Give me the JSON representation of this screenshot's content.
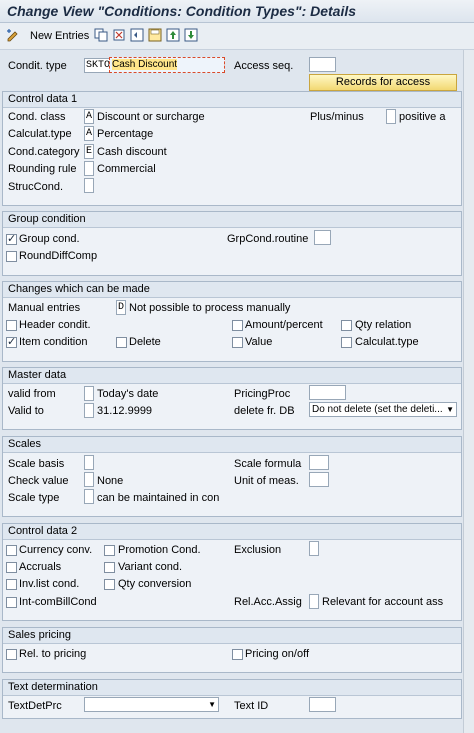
{
  "title": "Change View \"Conditions: Condition Types\": Details",
  "toolbar": {
    "new_entries": "New Entries"
  },
  "header": {
    "condit_type_label": "Condit. type",
    "condit_type_code": "SKTO",
    "condit_type_name": "Cash Discount",
    "access_seq_label": "Access seq.",
    "records_button": "Records for access"
  },
  "control1": {
    "title": "Control data 1",
    "cond_class_label": "Cond. class",
    "cond_class_val": "A",
    "cond_class_text": "Discount or surcharge",
    "plus_minus_label": "Plus/minus",
    "plus_minus_text": "positive a",
    "calculat_label": "Calculat.type",
    "calculat_val": "A",
    "calculat_text": "Percentage",
    "cond_category_label": "Cond.category",
    "cond_category_val": "E",
    "cond_category_text": "Cash discount",
    "rounding_label": "Rounding rule",
    "rounding_text": "Commercial",
    "struc_label": "StrucCond."
  },
  "group_condition": {
    "title": "Group condition",
    "group_cond": "Group cond.",
    "grp_routine": "GrpCond.routine",
    "round_diff": "RoundDiffComp"
  },
  "changes": {
    "title": "Changes which can be made",
    "manual_label": "Manual entries",
    "manual_val": "D",
    "manual_text": "Not possible to process manually",
    "header_condit": "Header condit.",
    "amount_percent": "Amount/percent",
    "qty_relation": "Qty relation",
    "item_condition": "Item condition",
    "delete": "Delete",
    "value": "Value",
    "calculat_type": "Calculat.type"
  },
  "master": {
    "title": "Master data",
    "valid_from_label": "valid from",
    "valid_from_text": "Today's date",
    "pricing_proc_label": "PricingProc",
    "valid_to_label": "Valid to",
    "valid_to_val": "31.12.9999",
    "delete_db_label": "delete fr. DB",
    "delete_db_val": "Do not delete (set the deleti..."
  },
  "scales": {
    "title": "Scales",
    "scale_basis": "Scale basis",
    "scale_formula": "Scale formula",
    "check_value": "Check value",
    "check_value_text": "None",
    "unit_meas": "Unit of meas.",
    "scale_type": "Scale type",
    "scale_type_text": "can be maintained in con"
  },
  "control2": {
    "title": "Control data 2",
    "currency_conv": "Currency conv.",
    "promotion_cond": "Promotion Cond.",
    "exclusion": "Exclusion",
    "accruals": "Accruals",
    "variant_cond": "Variant cond.",
    "invlist_cond": "Inv.list cond.",
    "qty_conversion": "Qty conversion",
    "intcom": "Int-comBillCond",
    "relacc_label": "Rel.Acc.Assig",
    "relacc_text": "Relevant for account ass"
  },
  "sales": {
    "title": "Sales pricing",
    "rel_pricing": "Rel. to pricing",
    "pricing_onoff": "Pricing on/off"
  },
  "textdet": {
    "title": "Text determination",
    "textdetprc": "TextDetPrc",
    "text_id": "Text ID"
  }
}
